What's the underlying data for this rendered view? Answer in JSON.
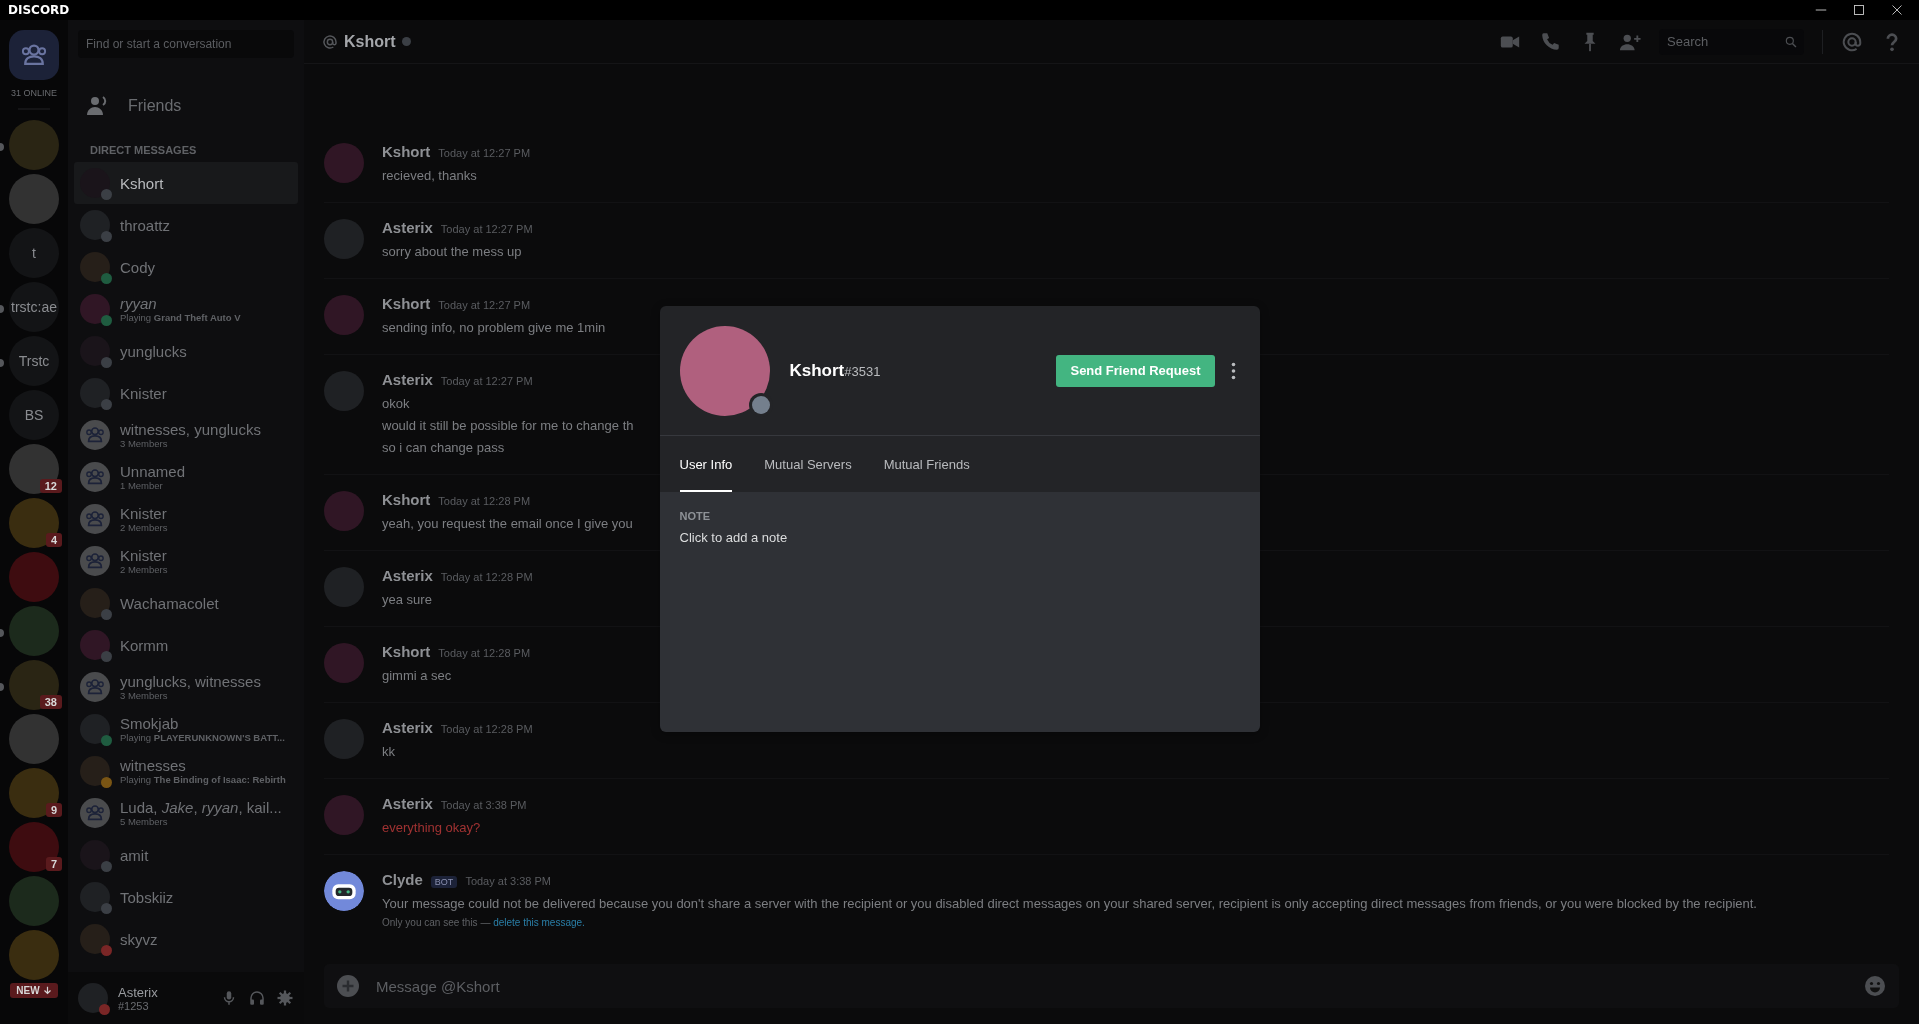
{
  "window": {
    "title": "DISCORD"
  },
  "servers": {
    "online": "31 ONLINE",
    "items": [
      {
        "kind": "image",
        "unread": true
      },
      {
        "kind": "image",
        "unread": false
      },
      {
        "kind": "text",
        "label": "t",
        "unread": false
      },
      {
        "kind": "text",
        "label": "trstc:ae",
        "unread": true
      },
      {
        "kind": "text",
        "label": "Trstc",
        "unread": true
      },
      {
        "kind": "text",
        "label": "BS",
        "unread": false
      },
      {
        "kind": "image",
        "unread": false,
        "badge": "12"
      },
      {
        "kind": "image",
        "unread": false,
        "badge": "4"
      },
      {
        "kind": "image",
        "unread": false
      },
      {
        "kind": "image",
        "unread": true
      },
      {
        "kind": "image",
        "unread": true,
        "badge": "38"
      },
      {
        "kind": "image",
        "unread": false
      },
      {
        "kind": "image",
        "unread": false,
        "badge": "9"
      },
      {
        "kind": "image",
        "unread": false,
        "badge": "7"
      },
      {
        "kind": "image",
        "unread": false
      },
      {
        "kind": "new",
        "unread": false,
        "badge": "NEW"
      }
    ]
  },
  "dm": {
    "search": {
      "placeholder": "Find or start a conversation"
    },
    "friends": "Friends",
    "header": "DIRECT MESSAGES",
    "items": [
      {
        "kind": "user",
        "name": "Kshort",
        "color": "#3b3f45",
        "selected": true
      },
      {
        "kind": "user",
        "name": "throattz",
        "color": "#3b3f45",
        "selected": false
      },
      {
        "kind": "user",
        "name": "Cody",
        "color": "#1f5c40",
        "selected": false
      },
      {
        "kind": "user",
        "name": "ryyan",
        "italic": true,
        "sub": "Playing **Grand Theft Auto V**",
        "color": "#1f5c40",
        "selected": false
      },
      {
        "kind": "user",
        "name": "yunglucks",
        "color": "#3b3f45",
        "selected": false
      },
      {
        "kind": "user",
        "name": "Knister",
        "color": "#3b3f45",
        "selected": false
      },
      {
        "kind": "group",
        "name": "witnesses, yunglucks",
        "sub": "3 Members",
        "selected": false
      },
      {
        "kind": "group",
        "name": "Unnamed",
        "sub": "1 Member",
        "selected": false
      },
      {
        "kind": "group",
        "name": "Knister",
        "sub": "2 Members",
        "selected": false
      },
      {
        "kind": "group",
        "name": "Knister",
        "sub": "2 Members",
        "selected": false
      },
      {
        "kind": "user",
        "name": "Wachamacolet",
        "color": "#3b3f45",
        "selected": false
      },
      {
        "kind": "user",
        "name": "Kormm",
        "color": "#3b3f45",
        "selected": false
      },
      {
        "kind": "group",
        "name": "yunglucks, witnesses",
        "sub": "3 Members",
        "selected": false
      },
      {
        "kind": "user",
        "name": "Smokjab",
        "sub": "Playing **PLAYERUNKNOWN'S BATT...**",
        "color": "#1f5c40",
        "selected": false
      },
      {
        "kind": "user",
        "name": "witnesses",
        "sub": "Playing **The Binding of Isaac: Rebirth**",
        "color": "#7a5514",
        "selected": false
      },
      {
        "kind": "group",
        "name": "Luda, *Jake*, *ryyan*, kail...",
        "sub": "5 Members",
        "selected": false
      },
      {
        "kind": "user",
        "name": "amit",
        "color": "#3b3f45",
        "selected": false
      },
      {
        "kind": "user",
        "name": "Tobskiiz",
        "color": "#3b3f45",
        "selected": false
      },
      {
        "kind": "user",
        "name": "skyvz",
        "color": "#7a2626",
        "selected": false
      }
    ]
  },
  "user_panel": {
    "name": "Asterix",
    "tag": "#1253",
    "color": "#7a2626"
  },
  "chat": {
    "title": "Kshort",
    "color": "#3b3f45",
    "search": {
      "placeholder": "Search"
    },
    "messages": [
      {
        "kind": "photo",
        "author": "Kshort",
        "time": "Today at 12:27 PM",
        "lines": [
          "recieved, thanks"
        ]
      },
      {
        "kind": "photo",
        "author": "Asterix",
        "time": "Today at 12:27 PM",
        "lines": [
          "sorry about the mess up"
        ]
      },
      {
        "kind": "photo",
        "author": "Kshort",
        "time": "Today at 12:27 PM",
        "lines": [
          "sending info, no problem give me 1min"
        ]
      },
      {
        "kind": "photo",
        "author": "Asterix",
        "time": "Today at 12:27 PM",
        "lines": [
          "okok",
          "would it still be possible for me to change th",
          "so i can change pass"
        ]
      },
      {
        "kind": "photo",
        "author": "Kshort",
        "time": "Today at 12:28 PM",
        "lines": [
          "yeah, you request the email once I give you"
        ]
      },
      {
        "kind": "photo",
        "author": "Asterix",
        "time": "Today at 12:28 PM",
        "lines": [
          "yea sure"
        ]
      },
      {
        "kind": "photo",
        "author": "Kshort",
        "time": "Today at 12:28 PM",
        "lines": [
          "gimmi a sec"
        ]
      },
      {
        "kind": "photo",
        "author": "Asterix",
        "time": "Today at 12:28 PM",
        "lines": [
          "kk"
        ]
      },
      {
        "kind": "photo",
        "author": "Asterix",
        "time": "Today at 3:38 PM",
        "failed": true,
        "lines": [
          "everything okay?"
        ]
      },
      {
        "kind": "bot",
        "author": "Clyde",
        "tag": "BOT",
        "time": "Today at 3:38 PM",
        "lines": [
          "Your message could not be delivered because you don't share a server with the recipient or you disabled direct messages on your shared server, recipient is only accepting direct messages from friends, or you were blocked by the recipient."
        ],
        "note": "Only you can see this — ",
        "note_link": "delete this message."
      }
    ],
    "input": {
      "placeholder": "Message @Kshort"
    }
  },
  "profile": {
    "name": "Kshort",
    "discriminator": "#3531",
    "color": "#747f8d",
    "button": "Send Friend Request",
    "tabs": [
      {
        "label": "User Info",
        "selected": true
      },
      {
        "label": "Mutual Servers",
        "selected": false
      },
      {
        "label": "Mutual Friends",
        "selected": false
      }
    ],
    "note": {
      "label": "NOTE",
      "placeholder": "Click to add a note"
    }
  }
}
